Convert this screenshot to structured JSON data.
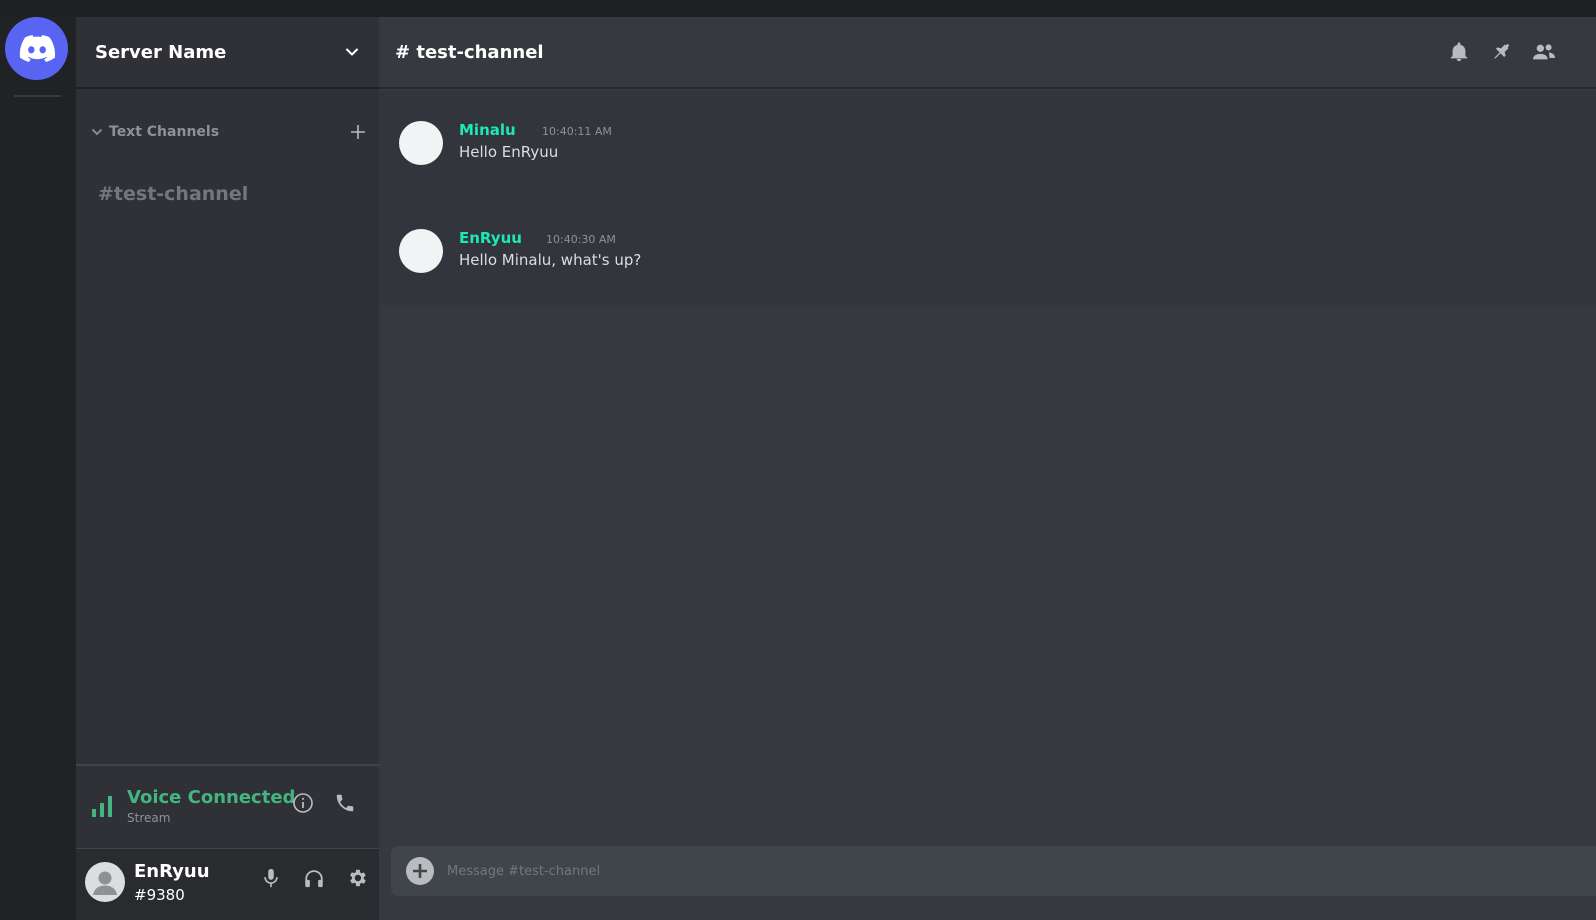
{
  "colors": {
    "accent": "#5865f2",
    "voice_green": "#43b581",
    "author_teal": "#1de9b6"
  },
  "server": {
    "name": "Server Name"
  },
  "sidebar": {
    "category_label": "Text Channels",
    "channels": [
      "#test-channel"
    ]
  },
  "voice": {
    "title": "Voice Connected",
    "subtitle": "Stream"
  },
  "user": {
    "name": "EnRyuu",
    "tag": "#9380"
  },
  "chat": {
    "channel_title": "# test-channel",
    "messages": [
      {
        "author": "Minalu",
        "time": "10:40:11 AM",
        "text": "Hello EnRyuu"
      },
      {
        "author": "EnRyuu",
        "time": "10:40:30 AM",
        "text": "Hello Minalu, what's up?"
      }
    ]
  },
  "composer": {
    "placeholder": "Message #test-channel"
  },
  "icons": {
    "header": [
      "bell-icon",
      "pin-icon",
      "members-icon"
    ],
    "voice": [
      "signal-icon",
      "info-icon",
      "phone-icon"
    ],
    "user": [
      "microphone-icon",
      "headphones-icon",
      "gear-icon"
    ]
  }
}
